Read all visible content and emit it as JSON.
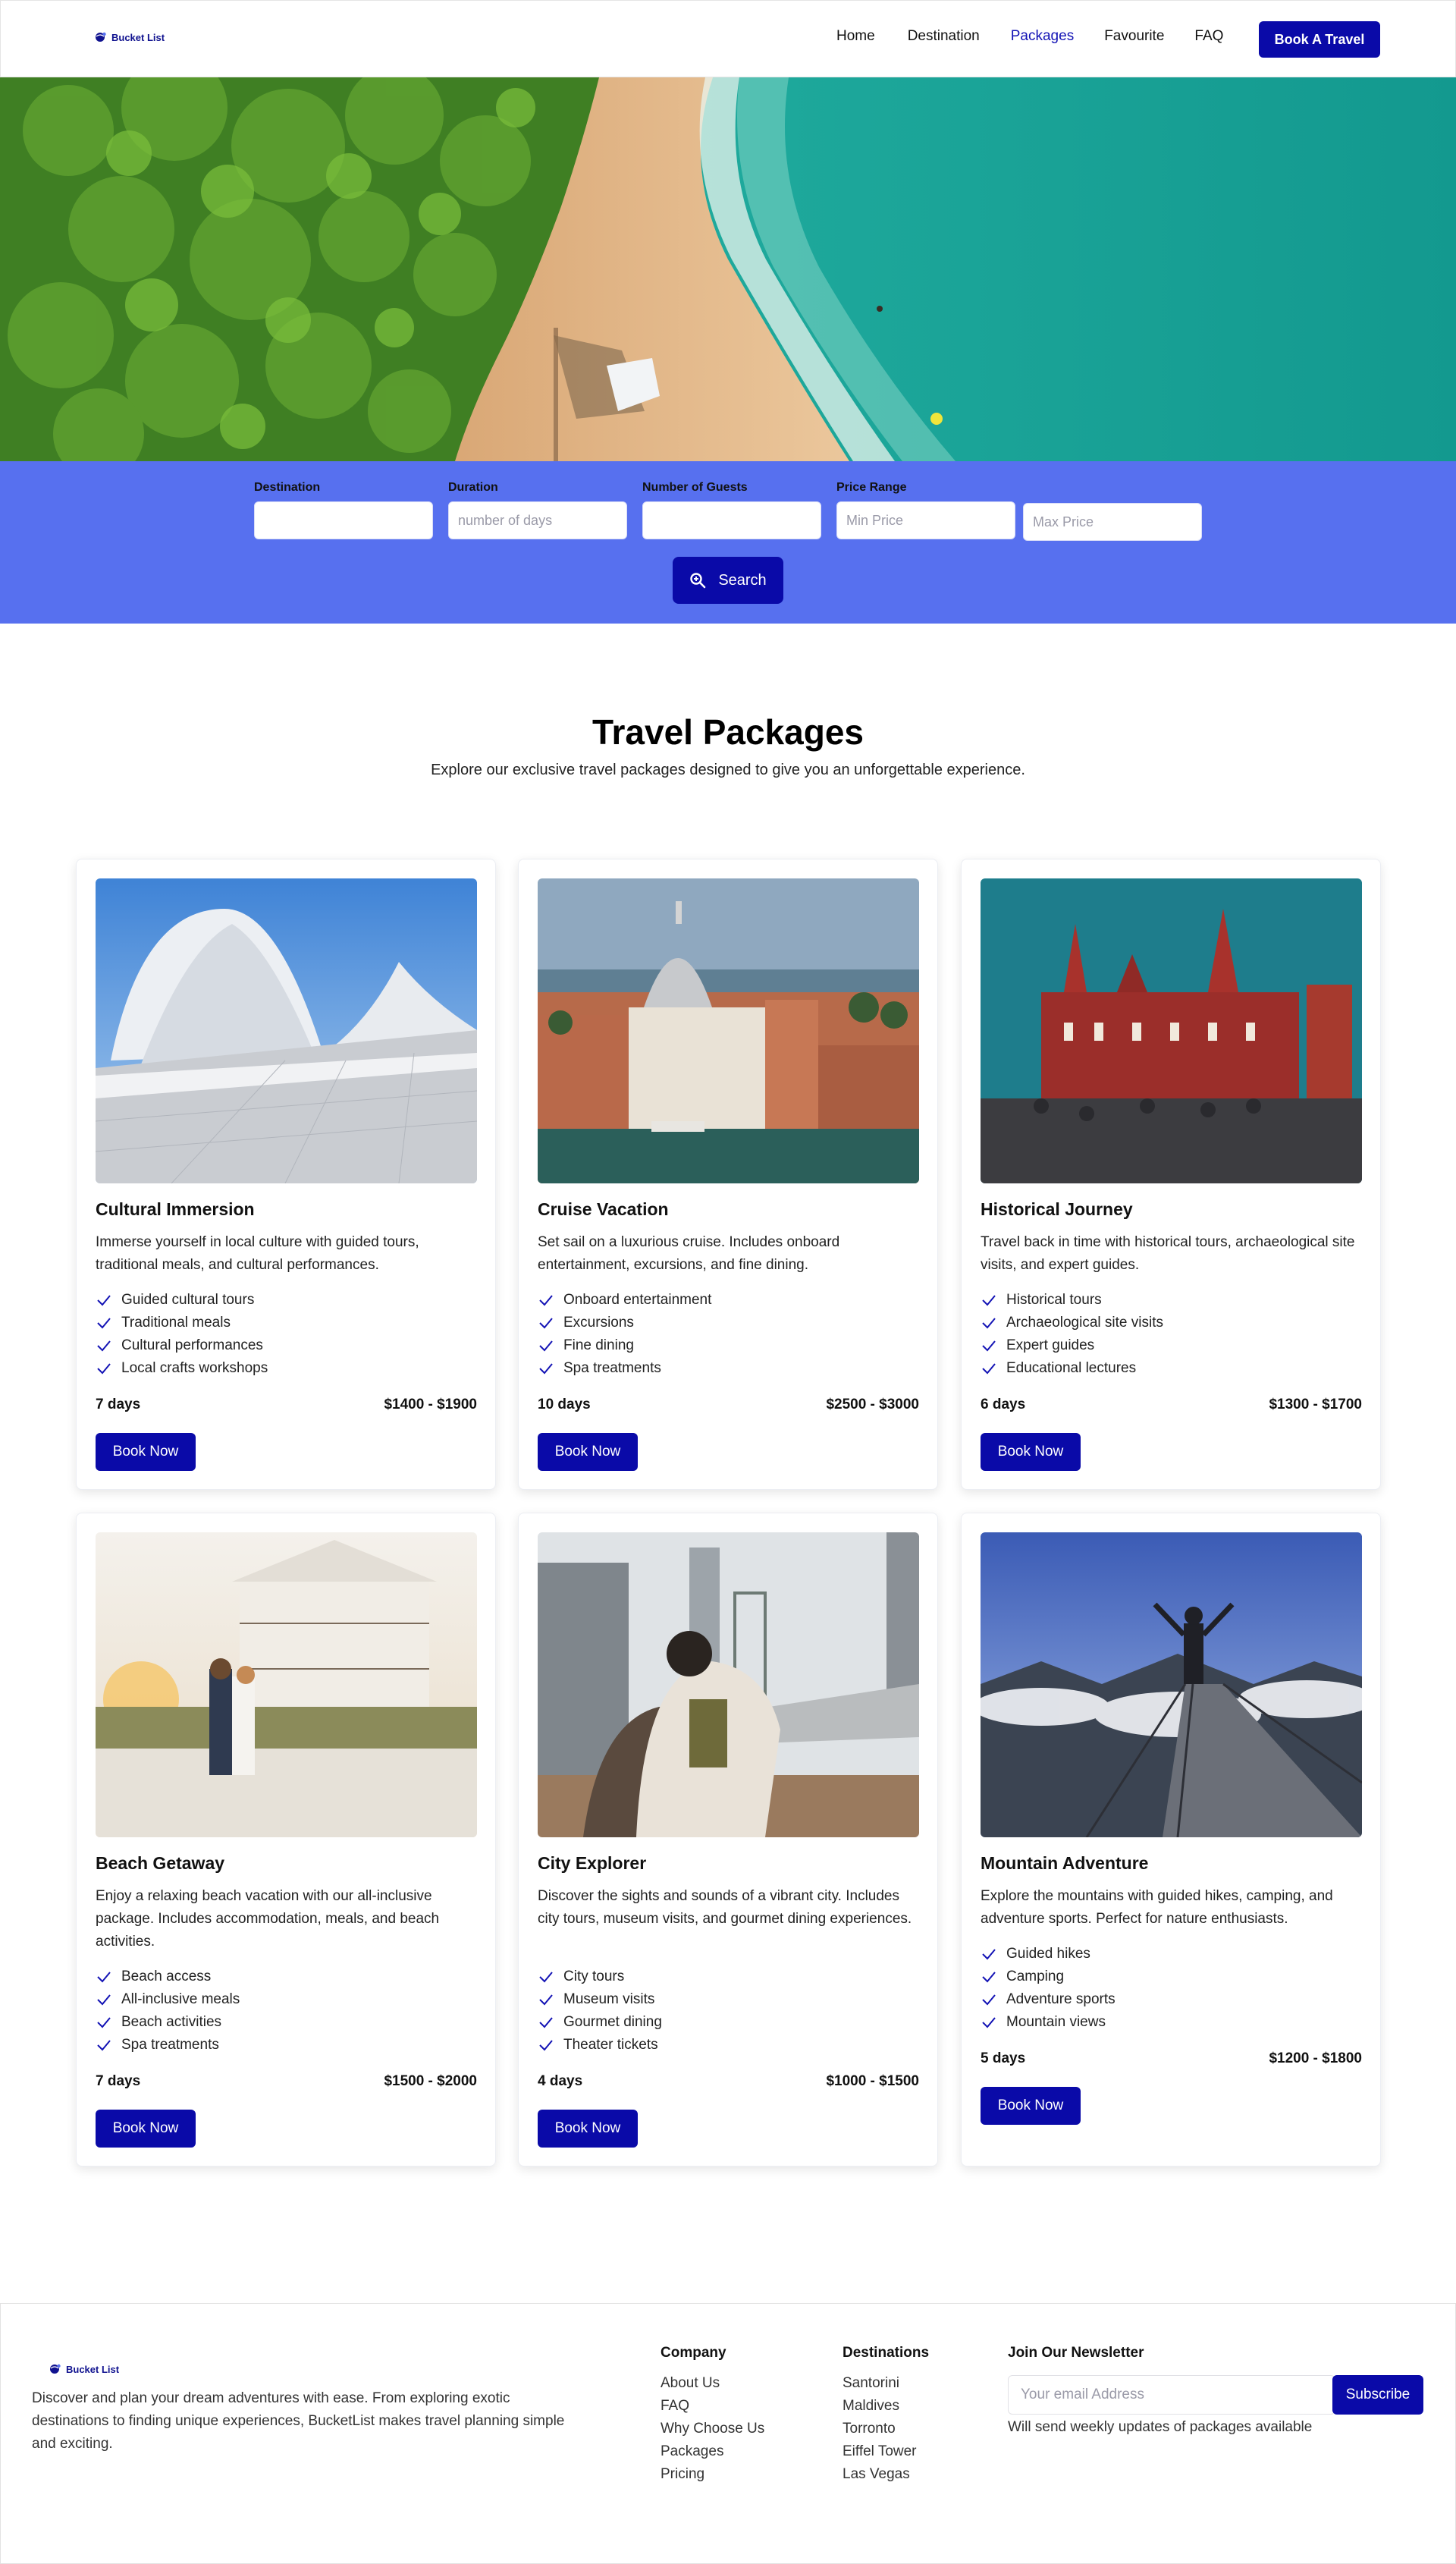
{
  "brand": {
    "name": "Bucket List",
    "logo_icon": "globe-icon",
    "accent": "#0a0aa8",
    "band": "#5770ef"
  },
  "nav": {
    "links": [
      "Home",
      "Destination",
      "Packages",
      "Favourite",
      "FAQ"
    ],
    "active": "Packages",
    "cta": "Book A Travel"
  },
  "search": {
    "fields": [
      {
        "label": "Destination",
        "placeholder": ""
      },
      {
        "label": "Duration",
        "placeholder": "number of days"
      },
      {
        "label": "Number of Guests",
        "placeholder": ""
      },
      {
        "label": "Price Range",
        "placeholder": "Min Price"
      },
      {
        "label": "",
        "placeholder": "Max Price"
      }
    ],
    "button": "Search",
    "button_icon": "zoom-search-icon"
  },
  "section": {
    "title": "Travel Packages",
    "subtitle": "Explore our exclusive travel packages designed to give you an unforgettable experience."
  },
  "packages": [
    {
      "title": "Cultural Immersion",
      "description": "Immerse yourself in local culture with guided tours, traditional meals, and cultural performances.",
      "features": [
        "Guided cultural tours",
        "Traditional meals",
        "Cultural performances",
        "Local crafts workshops"
      ],
      "duration": "7 days",
      "price": "$1400 - $1900",
      "button": "Book Now"
    },
    {
      "title": "Cruise Vacation",
      "description": "Set sail on a luxurious cruise. Includes onboard entertainment, excursions, and fine dining.",
      "features": [
        "Onboard entertainment",
        "Excursions",
        "Fine dining",
        "Spa treatments"
      ],
      "duration": "10 days",
      "price": "$2500 - $3000",
      "button": "Book Now"
    },
    {
      "title": "Historical Journey",
      "description": "Travel back in time with historical tours, archaeological site visits, and expert guides.",
      "features": [
        "Historical tours",
        "Archaeological site visits",
        "Expert guides",
        "Educational lectures"
      ],
      "duration": "6 days",
      "price": "$1300 - $1700",
      "button": "Book Now"
    },
    {
      "title": "Beach Getaway",
      "description": "Enjoy a relaxing beach vacation with our all-inclusive package. Includes accommodation, meals, and beach activities.",
      "features": [
        "Beach access",
        "All-inclusive meals",
        "Beach activities",
        "Spa treatments"
      ],
      "duration": "7 days",
      "price": "$1500 - $2000",
      "button": "Book Now"
    },
    {
      "title": "City Explorer",
      "description": "Discover the sights and sounds of a vibrant city. Includes city tours, museum visits, and gourmet dining experiences.",
      "features": [
        "City tours",
        "Museum visits",
        "Gourmet dining",
        "Theater tickets"
      ],
      "duration": "4 days",
      "price": "$1000 - $1500",
      "button": "Book Now"
    },
    {
      "title": "Mountain Adventure",
      "description": "Explore the mountains with guided hikes, camping, and adventure sports. Perfect for nature enthusiasts.",
      "features": [
        "Guided hikes",
        "Camping",
        "Adventure sports",
        "Mountain views"
      ],
      "duration": "5 days",
      "price": "$1200 - $1800",
      "button": "Book Now"
    }
  ],
  "footer": {
    "description": "Discover and plan your dream adventures with ease. From exploring exotic destinations to finding unique experiences, BucketList makes travel planning simple and exciting.",
    "company": {
      "heading": "Company",
      "links": [
        "About Us",
        "FAQ",
        "Why Choose Us",
        "Packages",
        "Pricing"
      ]
    },
    "destinations": {
      "heading": "Destinations",
      "links": [
        "Santorini",
        "Maldives",
        "Torronto",
        "Eiffel Tower",
        "Las Vegas"
      ]
    },
    "newsletter": {
      "heading": "Join Our Newsletter",
      "placeholder": "Your email Address",
      "button": "Subscribe",
      "note": "Will send weekly updates of packages available"
    }
  }
}
